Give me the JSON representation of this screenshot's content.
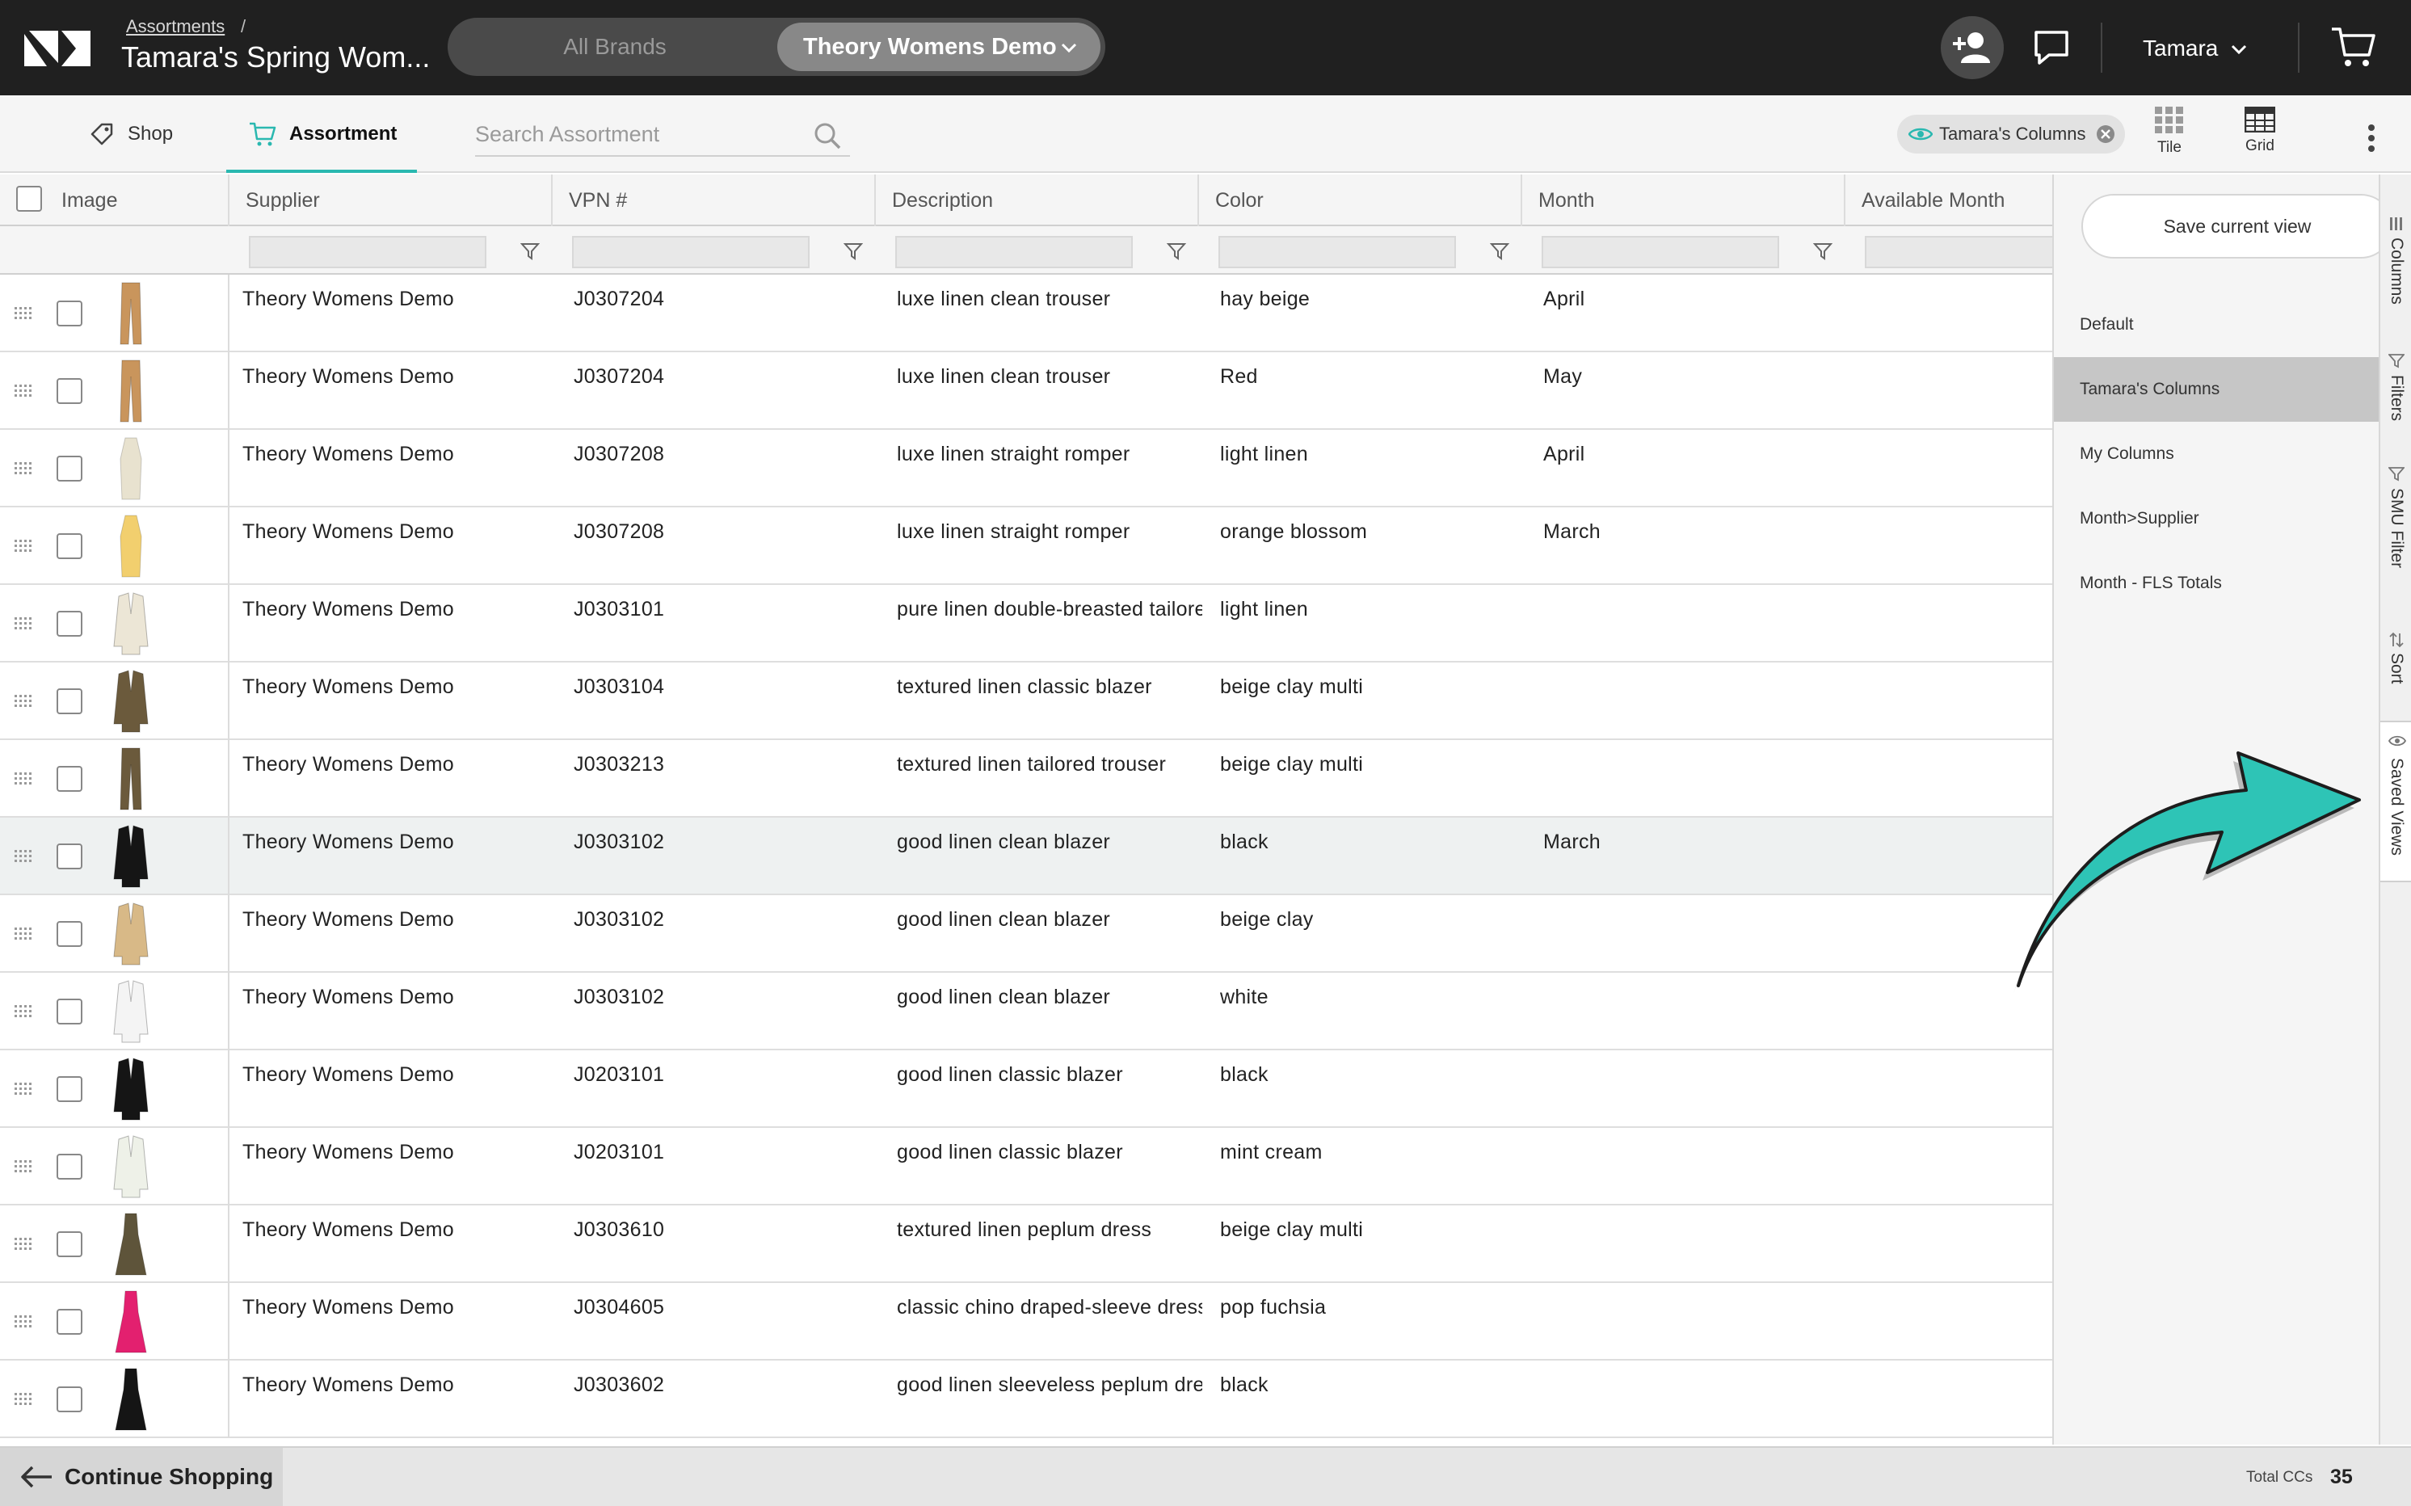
{
  "header": {
    "breadcrumb_link": "Assortments",
    "breadcrumb_sep": "/",
    "title": "Tamara's Spring Wom...",
    "brand_all": "All Brands",
    "brand_active": "Theory Womens Demo",
    "user_name": "Tamara"
  },
  "toolbar": {
    "shop_label": "Shop",
    "assortment_label": "Assortment",
    "search_placeholder": "Search Assortment",
    "view_chip": "Tamara's Columns",
    "tile_label": "Tile",
    "grid_label": "Grid"
  },
  "grid": {
    "columns": [
      "Image",
      "Supplier",
      "VPN #",
      "Description",
      "Color",
      "Month",
      "Available Month"
    ],
    "rows": [
      {
        "supplier": "Theory Womens Demo",
        "vpn": "J0307204",
        "description": "luxe linen clean trouser",
        "color": "hay beige",
        "month": "April",
        "thumb": "trouser",
        "tint": "#c9955c"
      },
      {
        "supplier": "Theory Womens Demo",
        "vpn": "J0307204",
        "description": "luxe linen clean trouser",
        "color": "Red",
        "month": "May",
        "thumb": "trouser",
        "tint": "#c9955c"
      },
      {
        "supplier": "Theory Womens Demo",
        "vpn": "J0307208",
        "description": "luxe linen straight romper",
        "color": "light linen",
        "month": "April",
        "thumb": "romper",
        "tint": "#e8e2cf"
      },
      {
        "supplier": "Theory Womens Demo",
        "vpn": "J0307208",
        "description": "luxe linen straight romper",
        "color": "orange blossom",
        "month": "March",
        "thumb": "romper",
        "tint": "#f2cf6e"
      },
      {
        "supplier": "Theory Womens Demo",
        "vpn": "J0303101",
        "description": "pure linen double-breasted tailored blazer",
        "color": "light linen",
        "month": "",
        "thumb": "blazer",
        "tint": "#ece6d6"
      },
      {
        "supplier": "Theory Womens Demo",
        "vpn": "J0303104",
        "description": "textured linen classic blazer",
        "color": "beige clay multi",
        "month": "",
        "thumb": "blazer",
        "tint": "#6b5a3c"
      },
      {
        "supplier": "Theory Womens Demo",
        "vpn": "J0303213",
        "description": "textured linen tailored trouser",
        "color": "beige clay multi",
        "month": "",
        "thumb": "trouser",
        "tint": "#6b5a3c"
      },
      {
        "supplier": "Theory Womens Demo",
        "vpn": "J0303102",
        "description": "good linen clean blazer",
        "color": "black",
        "month": "March",
        "thumb": "blazer",
        "tint": "#151515"
      },
      {
        "supplier": "Theory Womens Demo",
        "vpn": "J0303102",
        "description": "good linen clean blazer",
        "color": "beige clay",
        "month": "",
        "thumb": "blazer",
        "tint": "#d8b987"
      },
      {
        "supplier": "Theory Womens Demo",
        "vpn": "J0303102",
        "description": "good linen clean blazer",
        "color": "white",
        "month": "",
        "thumb": "blazer",
        "tint": "#f4f4f4"
      },
      {
        "supplier": "Theory Womens Demo",
        "vpn": "J0203101",
        "description": "good linen classic blazer",
        "color": "black",
        "month": "",
        "thumb": "blazer",
        "tint": "#151515"
      },
      {
        "supplier": "Theory Womens Demo",
        "vpn": "J0203101",
        "description": "good linen classic blazer",
        "color": "mint cream",
        "month": "",
        "thumb": "blazer",
        "tint": "#eef1e8"
      },
      {
        "supplier": "Theory Womens Demo",
        "vpn": "J0303610",
        "description": "textured linen peplum dress",
        "color": "beige clay multi",
        "month": "",
        "thumb": "dress",
        "tint": "#5e543a"
      },
      {
        "supplier": "Theory Womens Demo",
        "vpn": "J0304605",
        "description": "classic chino draped-sleeve dress",
        "color": "pop fuchsia",
        "month": "",
        "thumb": "dress",
        "tint": "#e3206f"
      },
      {
        "supplier": "Theory Womens Demo",
        "vpn": "J0303602",
        "description": "good linen sleeveless peplum dress",
        "color": "black",
        "month": "",
        "thumb": "dress",
        "tint": "#151515"
      }
    ]
  },
  "panel": {
    "save_label": "Save current view",
    "views": [
      "Default",
      "Tamara's Columns",
      "My Columns",
      "Month>Supplier",
      "Month - FLS Totals"
    ],
    "active_view": 1,
    "rail_tabs": [
      "Columns",
      "Filters",
      "SMU Filter",
      "Sort",
      "Saved Views"
    ]
  },
  "footer": {
    "continue_label": "Continue Shopping",
    "total_label": "Total CCs",
    "total_value": "35"
  },
  "colors": {
    "accent": "#2ab8b0",
    "topbar": "#202020",
    "arrow": "#2ec4b6"
  }
}
